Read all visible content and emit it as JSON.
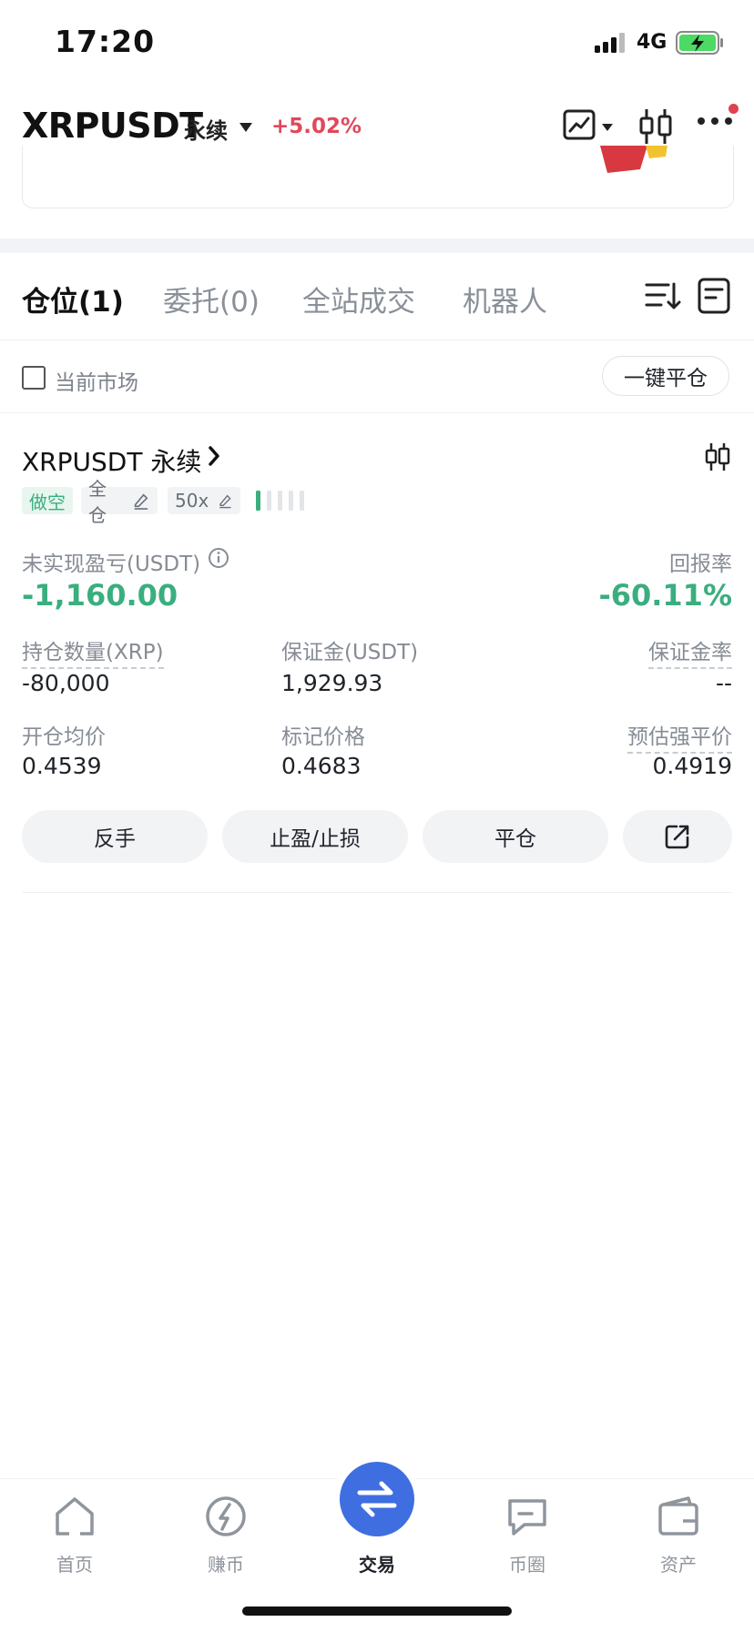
{
  "status_bar": {
    "time": "17:20",
    "network": "4G",
    "battery_charging": true
  },
  "header": {
    "pair": "XRPUSDT",
    "contract_type": "永续",
    "change": "+5.02%",
    "colors": {
      "up_red": "#e2475b",
      "down_green": "#3aae7f",
      "accent_blue": "#3f6ee0"
    }
  },
  "tabs": [
    {
      "label": "仓位(1)",
      "active": true
    },
    {
      "label": "委托(0)",
      "active": false
    },
    {
      "label": "全站成交",
      "active": false
    },
    {
      "label": "机器人",
      "active": false
    }
  ],
  "filter": {
    "current_market_label": "当前市场",
    "checked": false,
    "close_all_label": "一键平仓"
  },
  "position": {
    "title": "XRPUSDT 永续",
    "tags": {
      "side": "做空",
      "margin_mode": "全仓",
      "leverage": "50x"
    },
    "risk_level_bars": 1,
    "unrealized_pnl_label": "未实现盈亏(USDT)",
    "unrealized_pnl_value": "-1,160.00",
    "roe_label": "回报率",
    "roe_value": "-60.11%",
    "qty_label": "持仓数量(XRP)",
    "qty_value": "-80,000",
    "margin_label": "保证金(USDT)",
    "margin_value": "1,929.93",
    "margin_rate_label": "保证金率",
    "margin_rate_value": "--",
    "entry_label": "开仓均价",
    "entry_value": "0.4539",
    "mark_label": "标记价格",
    "mark_value": "0.4683",
    "liq_label": "预估强平价",
    "liq_value": "0.4919",
    "actions": {
      "reverse": "反手",
      "tpsl": "止盈/止损",
      "close": "平仓"
    }
  },
  "bottom_nav": [
    {
      "label": "首页",
      "icon": "home-icon"
    },
    {
      "label": "赚币",
      "icon": "earn-icon"
    },
    {
      "label": "交易",
      "icon": "trade-swap-icon",
      "active": true
    },
    {
      "label": "币圈",
      "icon": "chat-icon"
    },
    {
      "label": "资产",
      "icon": "wallet-icon"
    }
  ]
}
